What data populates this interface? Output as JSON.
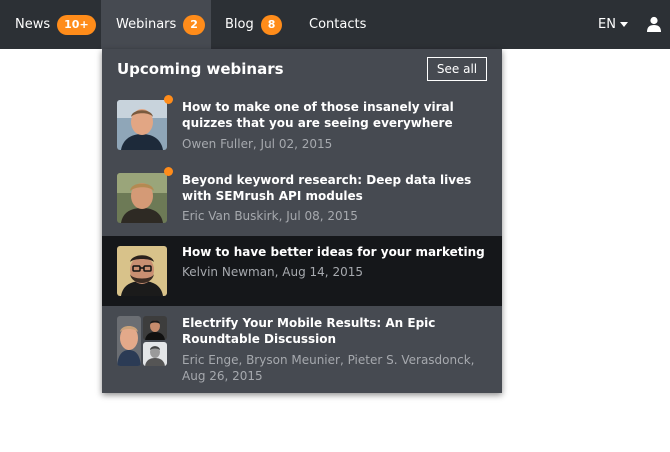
{
  "nav": {
    "items": [
      {
        "label": "News",
        "badge": "10+"
      },
      {
        "label": "Webinars",
        "badge": "2"
      },
      {
        "label": "Blog",
        "badge": "8"
      },
      {
        "label": "Contacts"
      }
    ],
    "language": "EN",
    "icons": {
      "language_caret": "chevron-down-icon",
      "user": "user-icon"
    }
  },
  "dropdown": {
    "title": "Upcoming webinars",
    "see_all_label": "See all",
    "webinars": [
      {
        "title": "How to make one of those insanely viral quizzes that you are seeing everywhere",
        "meta": "Owen Fuller, Jul 02, 2015",
        "new": true
      },
      {
        "title": "Beyond keyword research: Deep data lives with SEMrush API modules",
        "meta": "Eric Van Buskirk, Jul 08, 2015",
        "new": true
      },
      {
        "title": "How to have better ideas for your marketing",
        "meta": "Kelvin Newman, Aug 14, 2015",
        "new": false,
        "highlighted": true
      },
      {
        "title": "Electrify Your Mobile Results: An Epic Roundtable Discussion",
        "meta": "Eric Enge, Bryson Meunier, Pieter S. Verasdonck, Aug 26, 2015",
        "new": false
      }
    ]
  },
  "colors": {
    "topbar": "#2c3035",
    "active_tab": "#464a51",
    "panel": "#464a51",
    "highlight_row": "#15171a",
    "accent_orange": "#ff8c1a",
    "meta_text": "#a6a9ae"
  }
}
